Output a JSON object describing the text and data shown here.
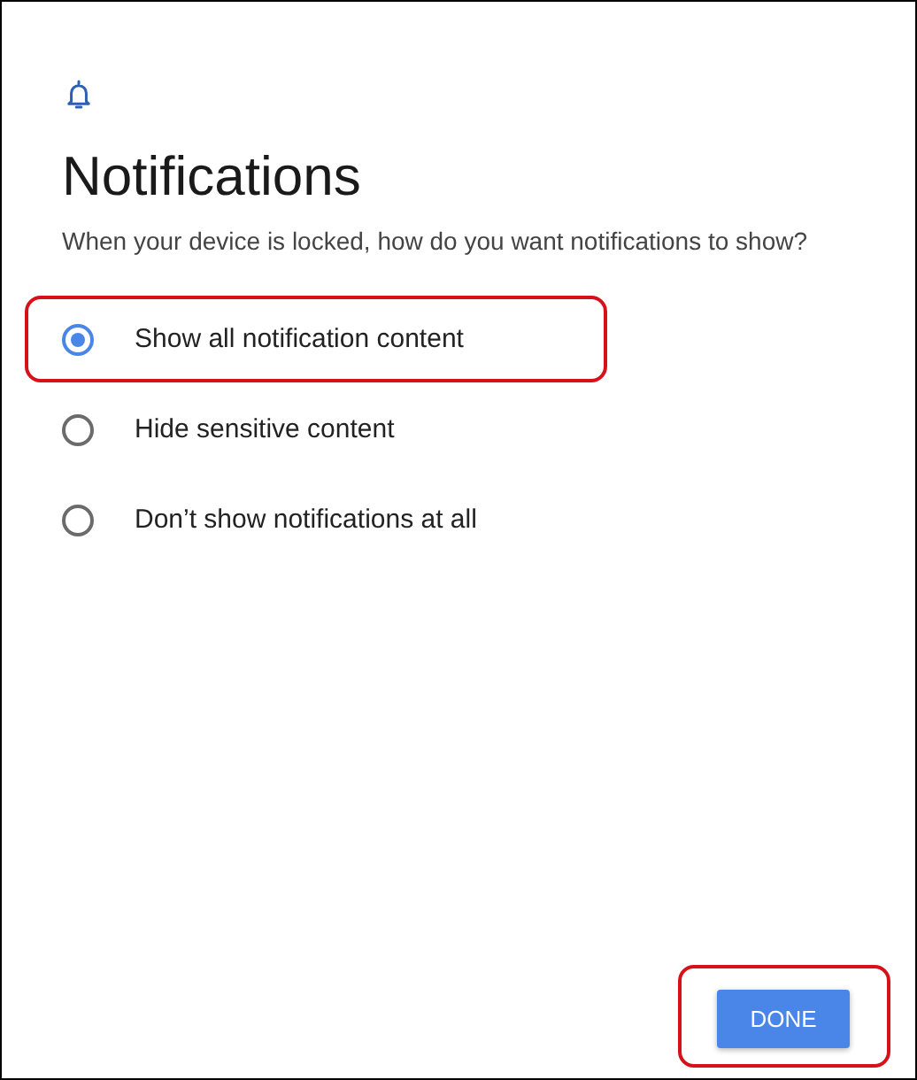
{
  "header": {
    "title": "Notifications",
    "subtitle": "When your device is locked, how do you want notifications to show?"
  },
  "options": [
    {
      "label": "Show all notification content",
      "selected": true,
      "highlighted": true
    },
    {
      "label": "Hide sensitive content",
      "selected": false,
      "highlighted": false
    },
    {
      "label": "Don’t show notifications at all",
      "selected": false,
      "highlighted": false
    }
  ],
  "done_button": {
    "label": "DONE",
    "highlighted": true
  }
}
